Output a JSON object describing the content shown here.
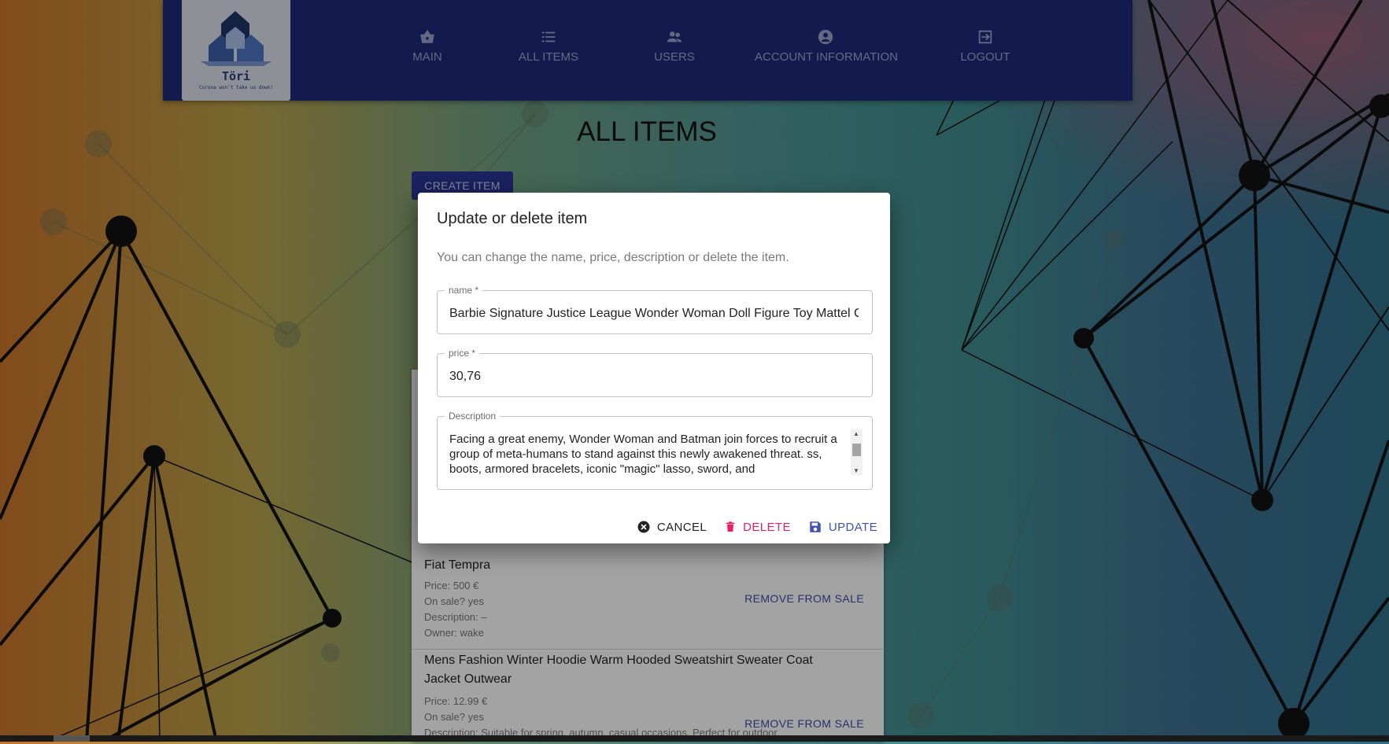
{
  "header": {
    "logo": {
      "title": "Töri",
      "subtitle": "Corona won't take us down!"
    },
    "nav": [
      {
        "label": "MAIN",
        "icon": "basket-icon"
      },
      {
        "label": "ALL ITEMS",
        "icon": "list-icon"
      },
      {
        "label": "USERS",
        "icon": "users-icon"
      },
      {
        "label": "ACCOUNT INFORMATION",
        "icon": "account-circle-icon"
      },
      {
        "label": "LOGOUT",
        "icon": "logout-icon"
      }
    ]
  },
  "main": {
    "title": "ALL ITEMS",
    "create_label": "CREATE ITEM",
    "items": [
      {
        "name": "Fiat Tempra",
        "price": "Price: 500 €",
        "on_sale": "On sale? yes",
        "description": "Description: –",
        "owner": "Owner: wake",
        "action": "REMOVE FROM SALE"
      },
      {
        "name": "Mens Fashion Winter Hoodie Warm Hooded Sweatshirt Sweater Coat Jacket Outwear",
        "price": "Price: 12.99 €",
        "on_sale": "On sale? yes",
        "description": "Description: Suitable for spring, autumn, casual occasions. Perfect for outdoor",
        "action": "REMOVE FROM SALE"
      }
    ]
  },
  "dialog": {
    "title": "Update or delete item",
    "text": "You can change the name, price, description or delete the item.",
    "name_label": "name *",
    "name_value": "Barbie Signature Justice League Wonder Woman Doll Figure Toy Mattel C",
    "price_label": "price *",
    "price_value": "30,76",
    "description_label": "Description",
    "description_value": "Facing a great enemy, Wonder Woman and Batman join forces to recruit a group of meta-humans to stand against this newly awakened threat. ss, boots, armored bracelets, iconic \"magic\" lasso, sword, and",
    "cancel_label": "CANCEL",
    "delete_label": "DELETE",
    "update_label": "UPDATE"
  },
  "colors": {
    "appbar": "#1e2a78",
    "primary": "#283593",
    "delete": "#e91e63",
    "update": "#3f51b5"
  }
}
